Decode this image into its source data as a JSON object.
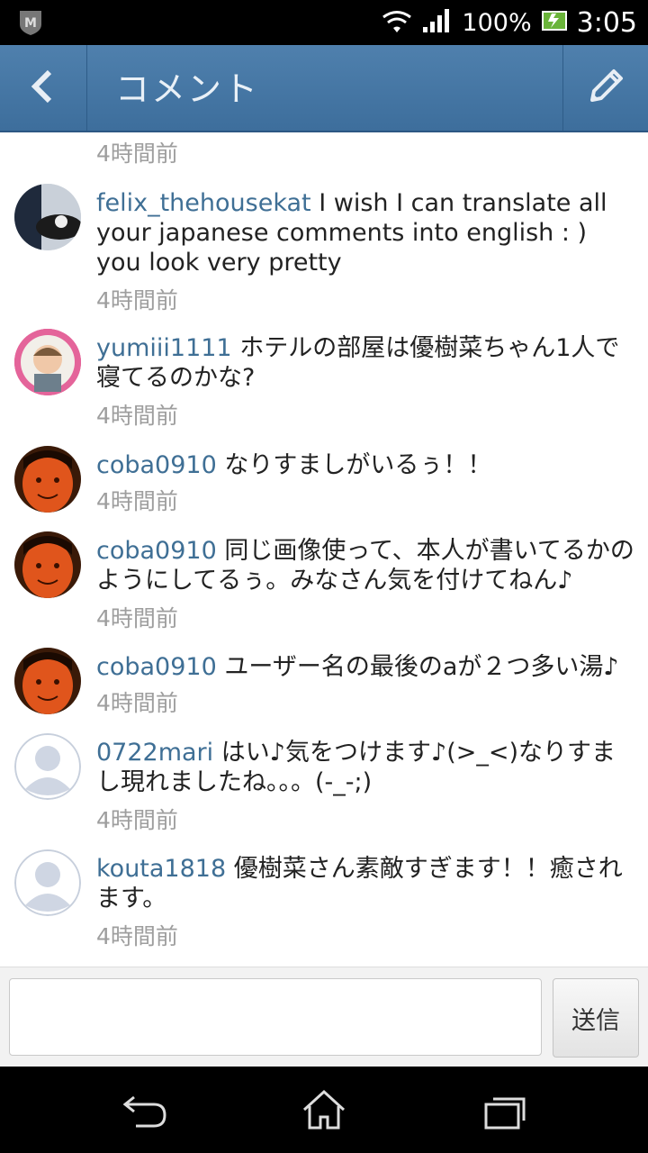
{
  "status_bar": {
    "battery": "100%",
    "time": "3:05"
  },
  "app_bar": {
    "title": "コメント"
  },
  "first_timestamp": "4時間前",
  "comments": [
    {
      "user": "felix_thehousekat",
      "text": "I wish I can translate all your japanese comments into english : ) you look very pretty",
      "time": "4時間前"
    },
    {
      "user": "yumiii1111",
      "text": "ホテルの部屋は優樹菜ちゃん1人で寝てるのかな?",
      "time": "4時間前"
    },
    {
      "user": "coba0910",
      "text": "なりすましがいるぅ！！",
      "time": "4時間前"
    },
    {
      "user": "coba0910",
      "text": "同じ画像使って、本人が書いてるかのようにしてるぅ。みなさん気を付けてねん♪",
      "time": "4時間前"
    },
    {
      "user": "coba0910",
      "text": "ユーザー名の最後のaが２つ多い湯♪",
      "time": "4時間前"
    },
    {
      "user": "0722mari",
      "text": "はい♪気をつけます♪(>_<)なりすまし現れましたね。。。(-_-;)",
      "time": "4時間前"
    },
    {
      "user": "kouta1818",
      "text": "優樹菜さん素敵すぎます！！癒されます。",
      "time": "4時間前"
    }
  ],
  "input": {
    "value": "",
    "send_label": "送信"
  },
  "colors": {
    "app_bar": "#4a7aa7",
    "username": "#3f6f95",
    "timestamp": "#9e9e9e"
  },
  "icons": {
    "back": "chevron-left-icon",
    "edit": "pencil-icon",
    "nav": [
      "back-icon",
      "home-icon",
      "recent-apps-icon"
    ]
  }
}
